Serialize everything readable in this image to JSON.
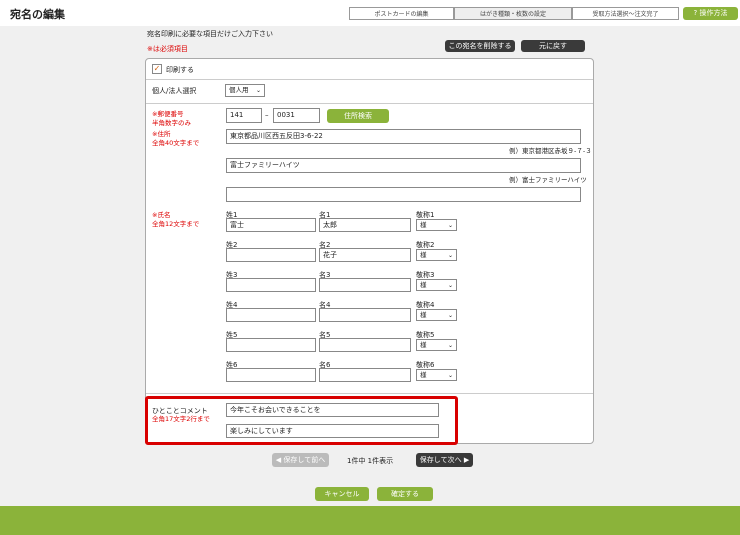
{
  "header": {
    "title": "宛名の編集",
    "help_label": "操作方法",
    "help_icon": "question-icon"
  },
  "steps": [
    "ポストカードの編集",
    "はがき種類・枚数の設定",
    "受取方法選択～注文完了"
  ],
  "instruction": "宛名印刷に必要な項目だけご入力下さい",
  "required_note": "※は必須項目",
  "actions": {
    "delete_label": "この宛名を削除する",
    "revert_label": "元に戻す"
  },
  "print_label": "印刷する",
  "print_checked": true,
  "type_select": {
    "label": "個人/法人選択",
    "value": "個人用"
  },
  "postal": {
    "label": "※郵便番号",
    "note": "半角数字のみ",
    "part1": "141",
    "part2": "0031",
    "search_label": "住所検索"
  },
  "address": {
    "label": "※住所",
    "note": "全角40文字まで",
    "line1": "東京都品川区西五反田3-6-22",
    "hint1": "例）東京都港区赤坂９-７-３",
    "line2": "富士ファミリーハイツ",
    "hint2": "例）富士ファミリーハイツ",
    "line3": ""
  },
  "names": {
    "label": "※氏名",
    "note": "全角12文字まで",
    "entries": [
      {
        "sei_label": "姓1",
        "sei": "富士",
        "mei_label": "名1",
        "mei": "太郎",
        "keisho_label": "敬称1",
        "keisho": "様"
      },
      {
        "sei_label": "姓2",
        "sei": "",
        "mei_label": "名2",
        "mei": "花子",
        "keisho_label": "敬称2",
        "keisho": "様"
      },
      {
        "sei_label": "姓3",
        "sei": "",
        "mei_label": "名3",
        "mei": "",
        "keisho_label": "敬称3",
        "keisho": "様"
      },
      {
        "sei_label": "姓4",
        "sei": "",
        "mei_label": "名4",
        "mei": "",
        "keisho_label": "敬称4",
        "keisho": "様"
      },
      {
        "sei_label": "姓5",
        "sei": "",
        "mei_label": "名5",
        "mei": "",
        "keisho_label": "敬称5",
        "keisho": "様"
      },
      {
        "sei_label": "姓6",
        "sei": "",
        "mei_label": "名6",
        "mei": "",
        "keisho_label": "敬称6",
        "keisho": "様"
      }
    ]
  },
  "comment": {
    "label": "ひとことコメント",
    "note": "全角17文字2行まで",
    "line1": "今年こそお会いできることを",
    "line2": "楽しみにしています"
  },
  "pager": {
    "prev_label": "保存して前へ",
    "status": "1件中 1件表示",
    "next_label": "保存して次へ"
  },
  "footer_buttons": {
    "cancel_label": "キャンセル",
    "confirm_label": "確定する"
  },
  "colors": {
    "accent": "#8bb33a",
    "required": "#dd0000",
    "highlight": "#d80000",
    "dark_button": "#3a3a3a"
  }
}
